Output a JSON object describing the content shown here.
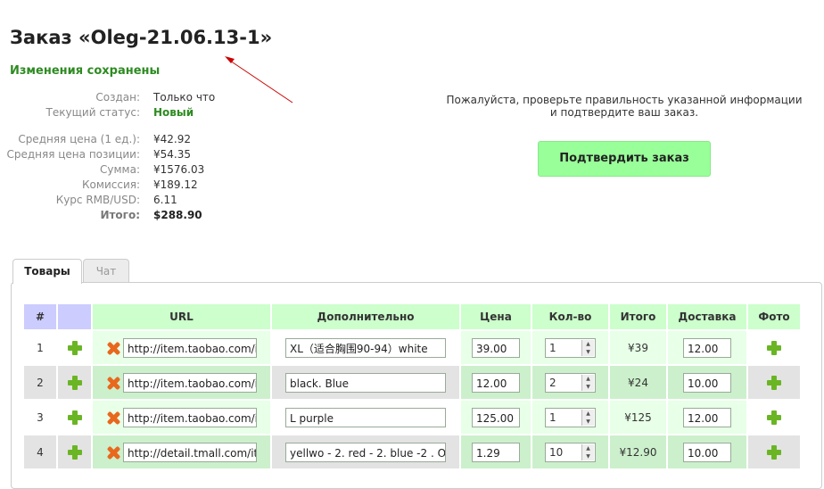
{
  "order": {
    "title": "Заказ «Oleg-21.06.13-1»",
    "saved_message": "Изменения сохранены"
  },
  "info": [
    {
      "label": "Создан:",
      "value": "Только что",
      "style": "normal"
    },
    {
      "label": "Текущий статус:",
      "value": "Новый",
      "style": "status"
    },
    {
      "label": "Средняя цена (1 ед.):",
      "value": "¥42.92",
      "style": "normal"
    },
    {
      "label": "Средняя цена позиции:",
      "value": "¥54.35",
      "style": "normal"
    },
    {
      "label": "Сумма:",
      "value": "¥1576.03",
      "style": "normal"
    },
    {
      "label": "Комиссия:",
      "value": "¥189.12",
      "style": "normal"
    },
    {
      "label": "Курс RMB/USD:",
      "value": "6.11",
      "style": "normal"
    },
    {
      "label": "Итого:",
      "value": "$288.90",
      "style": "total"
    }
  ],
  "confirm": {
    "text_line1": "Пожалуйста, проверьте правильность указанной информации",
    "text_line2": "и подтвердите ваш заказ.",
    "button_label": "Подтвердить заказ"
  },
  "tabs": [
    {
      "label": "Товары",
      "active": true
    },
    {
      "label": "Чат",
      "active": false
    }
  ],
  "table": {
    "headers": [
      "#",
      "",
      "URL",
      "Дополнительно",
      "Цена",
      "Кол-во",
      "Итого",
      "Доставка",
      "Фото"
    ],
    "rows": [
      {
        "num": "1",
        "url": "http://item.taobao.com/i",
        "extra": "XL（适合胸围90-94）white",
        "price": "39.00",
        "qty": "1",
        "total": "¥39",
        "delivery": "12.00"
      },
      {
        "num": "2",
        "url": "http://item.taobao.com/i",
        "extra": "black. Blue",
        "price": "12.00",
        "qty": "2",
        "total": "¥24",
        "delivery": "10.00"
      },
      {
        "num": "3",
        "url": "http://item.taobao.com/i",
        "extra": "L purple",
        "price": "125.00",
        "qty": "1",
        "total": "¥125",
        "delivery": "12.00"
      },
      {
        "num": "4",
        "url": "http://detail.tmall.com/it",
        "extra": "yellwo - 2. red - 2. blue -2 . O",
        "price": "1.29",
        "qty": "10",
        "total": "¥12.90",
        "delivery": "10.00"
      }
    ]
  },
  "colors": {
    "saved_green": "#2e8b22",
    "confirm_button": "#99ff99",
    "header_green": "#ccffcc",
    "header_blue": "#ccccff",
    "plus_icon": "#6ab524",
    "remove_icon": "#e8681e",
    "arrow": "#cc0000"
  }
}
